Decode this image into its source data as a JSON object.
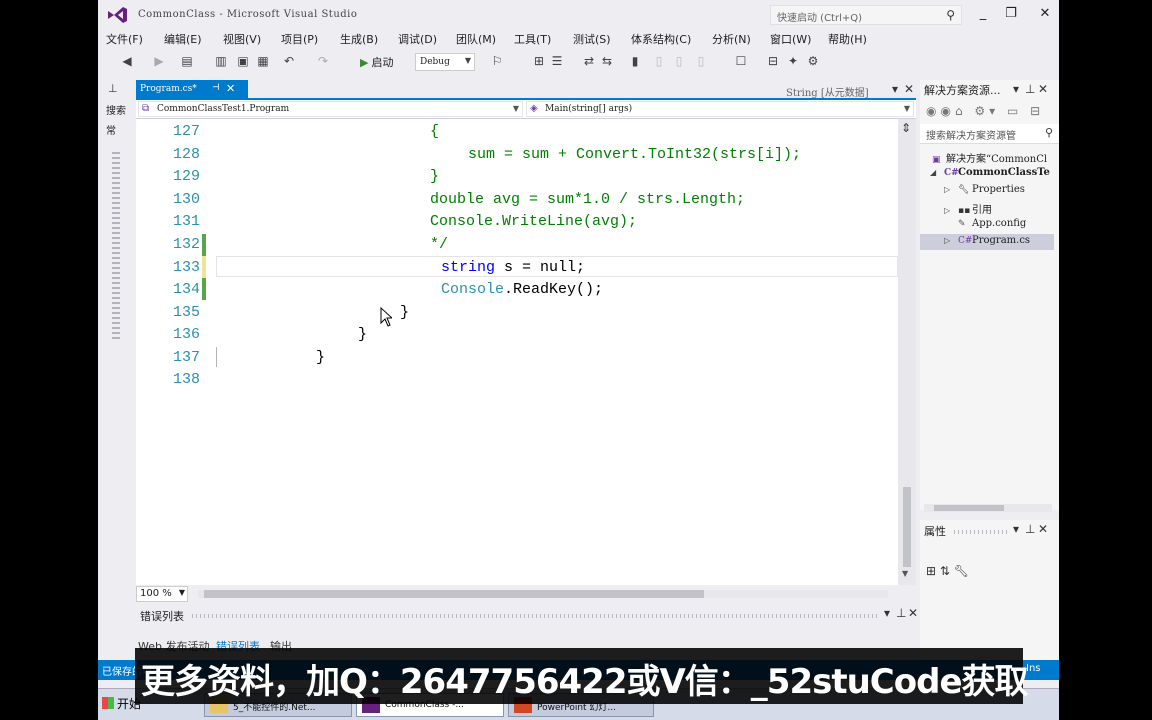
{
  "window": {
    "title": "CommonClass - Microsoft Visual Studio",
    "quick_launch": "快速启动 (Ctrl+Q)"
  },
  "menu": [
    "文件(F)",
    "编辑(E)",
    "视图(V)",
    "项目(P)",
    "生成(B)",
    "调试(D)",
    "团队(M)",
    "工具(T)",
    "测试(S)",
    "体系结构(C)",
    "分析(N)",
    "窗口(W)",
    "帮助(H)"
  ],
  "toolbar": {
    "start_label": "启动",
    "config": "Debug"
  },
  "left_panel": {
    "search_label": "搜索",
    "tab_label": "常"
  },
  "editor": {
    "tab_title": "Program.cs*",
    "tab_right_info": "String [从元数据]",
    "nav_class": "CommonClassTest1.Program",
    "nav_member": "Main(string[] args)",
    "zoom": "100 %",
    "lines": [
      {
        "num": "127",
        "code": "{"
      },
      {
        "num": "128",
        "code": "sum = sum + Convert.ToInt32(strs[i]);"
      },
      {
        "num": "129",
        "code": "}"
      },
      {
        "num": "130",
        "code": "double avg = sum*1.0 / strs.Length;"
      },
      {
        "num": "131",
        "code": "Console.WriteLine(avg);"
      },
      {
        "num": "132",
        "code": "*/"
      },
      {
        "num": "133",
        "code_kw": "string",
        "code_rest": " s = null;"
      },
      {
        "num": "134",
        "code_type": "Console",
        "code_rest": ".ReadKey();"
      },
      {
        "num": "135",
        "code": "}"
      },
      {
        "num": "136",
        "code": "}"
      },
      {
        "num": "137",
        "code": "}"
      },
      {
        "num": "138",
        "code": ""
      }
    ]
  },
  "error_list": {
    "title": "错误列表",
    "tabs": [
      "Web 发布活动",
      "错误列表",
      "输出"
    ]
  },
  "solution_explorer": {
    "title": "解决方案资源...",
    "search_placeholder": "搜索解决方案资源管",
    "items": [
      {
        "label": "解决方案“CommonCl"
      },
      {
        "label": "CommonClassTe"
      },
      {
        "label": "Properties"
      },
      {
        "label": "引用"
      },
      {
        "label": "App.config"
      },
      {
        "label": "Program.cs"
      }
    ]
  },
  "properties": {
    "title": "属性"
  },
  "status": {
    "left": "已保存的项",
    "right": "Ins"
  },
  "taskbar": {
    "start": "开始",
    "tasks": [
      "5_不能控件的.Net...",
      "CommonClass -...",
      "PowerPoint 幻灯..."
    ]
  },
  "banner": {
    "text": "更多资料，加Q：2647756422或V信：_52stuCode获取"
  },
  "colors": {
    "accent": "#007acc",
    "keyword": "#0000ff",
    "comment": "#008000",
    "type": "#2b91af",
    "line_number": "#2b91af"
  }
}
